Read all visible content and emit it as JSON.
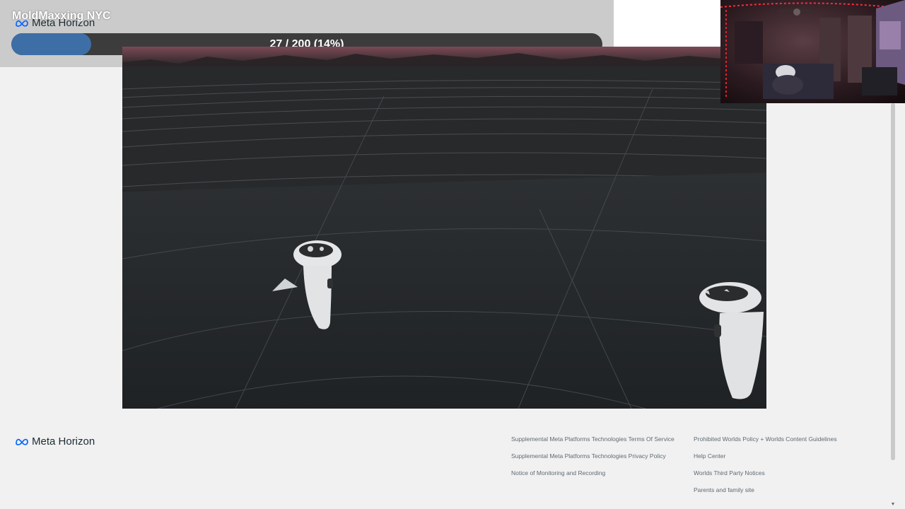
{
  "overlay": {
    "stream_title": "MoldMaxxing NYC",
    "brand": "Meta Horizon",
    "progress": {
      "label": "27 / 200 (14%)",
      "current": 27,
      "total": 200,
      "percent": 14
    }
  },
  "viewport": {
    "scene": "vr-grid-world",
    "controllers": [
      "left-controller",
      "right-controller"
    ]
  },
  "footer": {
    "brand": "Meta Horizon",
    "links_col1": [
      "Supplemental Meta Platforms Technologies Terms Of Service",
      "Supplemental Meta Platforms Technologies Privacy Policy",
      "Notice of Monitoring and Recording"
    ],
    "links_col2": [
      "Prohibited Worlds Policy + Worlds Content Guidelines",
      "Help Center",
      "Worlds Third Party Notices",
      "Parents and family site"
    ]
  },
  "icons": {
    "brand_logo": "meta-infinity-icon",
    "scroll_down": "chevron-down-icon"
  },
  "colors": {
    "progress_fill": "#3e6ea6",
    "progress_track": "#3c3c3c",
    "brand_blue": "#0866ff"
  }
}
